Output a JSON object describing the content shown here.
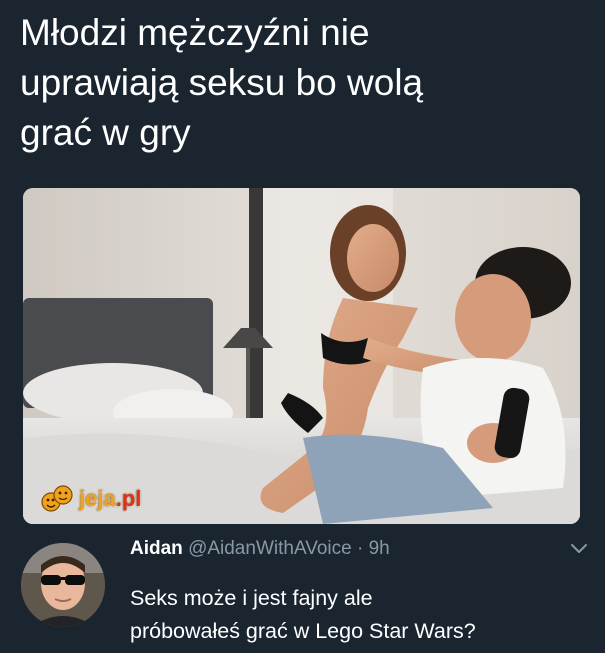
{
  "meme": {
    "headline_lines": [
      "Młodzi mężczyźni nie",
      "uprawiają seksu bo wolą",
      "grać w gry"
    ]
  },
  "watermark": {
    "main": "jeja",
    "suffix": ".pl",
    "icon": "jeja-smiley-logo-icon"
  },
  "tweet": {
    "author_name": "Aidan",
    "handle": "@AidanWithAVoice",
    "separator": "·",
    "time": "9h",
    "text_lines": [
      "Seks może i jest fajny ale",
      "próbowałeś grać w Lego Star Wars?"
    ],
    "menu_icon": "chevron-down-icon",
    "avatar_icon": "avatar"
  },
  "colors": {
    "background": "#1b2530",
    "text_primary": "#ffffff",
    "text_secondary": "#8899a6",
    "watermark_orange": "#f0a21c",
    "watermark_red": "#e0301e"
  }
}
